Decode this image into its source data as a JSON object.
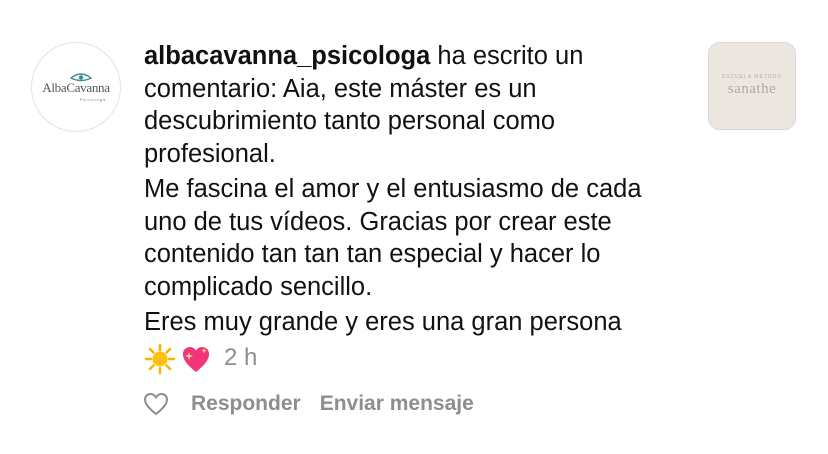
{
  "avatar": {
    "name": "AlbaCavanna",
    "subtitle": "Psicóloga",
    "icon": "eye-logo-icon"
  },
  "comment": {
    "username": "albacavanna_psicologa",
    "action_text": " ha escrito un comentario: Aia, este máster es un descubrimiento tanto personal como profesional.",
    "paragraph_2": "Me fascina el amor y el entusiasmo de cada uno de tus vídeos. Gracias por crear este contenido tan tan tan especial y hacer lo complicado sencillo.",
    "paragraph_3": "Eres muy grande y eres una gran persona",
    "emojis": [
      "sun-emoji",
      "sparkling-heart-emoji"
    ],
    "time": "2 h"
  },
  "thumbnail": {
    "small_text": "ESCUELA MÉTODO",
    "brand": "sanathe"
  },
  "actions": {
    "like_icon": "heart-icon",
    "reply_label": "Responder",
    "message_label": "Enviar mensaje"
  },
  "colors": {
    "text": "#111111",
    "muted": "#8e8e8e",
    "thumbnail_bg": "#ece6e0",
    "sun": "#ffb300",
    "heart": "#f2357a"
  }
}
